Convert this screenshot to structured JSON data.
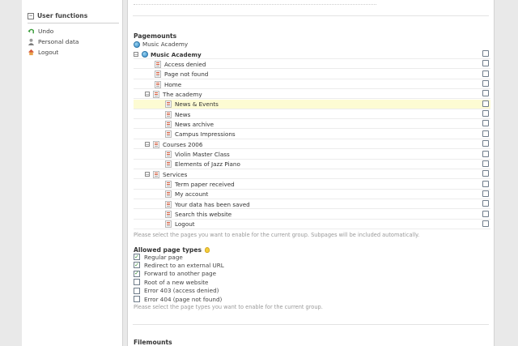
{
  "sidebar": {
    "header": "User functions",
    "items": [
      {
        "label": "Undo",
        "icon": "undo-icon",
        "color": "#3a9d3a"
      },
      {
        "label": "Personal data",
        "icon": "user-icon",
        "color": "#7a7a7a"
      },
      {
        "label": "Logout",
        "icon": "home-icon",
        "color": "#d4563a"
      }
    ]
  },
  "pagemounts": {
    "title": "Pagemounts",
    "root_label": "Music Academy",
    "tree": [
      {
        "label": "Music Academy",
        "bold": true,
        "level": 0,
        "expander": "−",
        "icon": "globe-icon"
      },
      {
        "label": "Access denied",
        "level": 1,
        "icon": "page-icon"
      },
      {
        "label": "Page not found",
        "level": 1,
        "icon": "page-icon"
      },
      {
        "label": "Home",
        "level": 1,
        "icon": "page-icon"
      },
      {
        "label": "The academy",
        "level": 1,
        "expander": "−",
        "icon": "page-icon"
      },
      {
        "label": "News & Events",
        "level": 2,
        "icon": "page-icon",
        "highlight": true
      },
      {
        "label": "News",
        "level": 2,
        "icon": "page-icon"
      },
      {
        "label": "News archive",
        "level": 2,
        "icon": "page-icon"
      },
      {
        "label": "Campus Impressions",
        "level": 2,
        "icon": "page-icon"
      },
      {
        "label": "Courses 2006",
        "level": 1,
        "expander": "−",
        "icon": "page-icon"
      },
      {
        "label": "Violin Master Class",
        "level": 2,
        "icon": "page-icon"
      },
      {
        "label": "Elements of Jazz Piano",
        "level": 2,
        "icon": "page-icon"
      },
      {
        "label": "Services",
        "level": 1,
        "expander": "−",
        "icon": "page-icon"
      },
      {
        "label": "Term paper received",
        "level": 2,
        "icon": "page-icon"
      },
      {
        "label": "My account",
        "level": 2,
        "icon": "page-icon"
      },
      {
        "label": "Your data has been saved",
        "level": 2,
        "icon": "page-icon"
      },
      {
        "label": "Search this website",
        "level": 2,
        "icon": "page-icon"
      },
      {
        "label": "Logout",
        "level": 2,
        "icon": "page-icon"
      }
    ],
    "note": "Please select the pages you want to enable for the current group. Subpages will be included automatically."
  },
  "page_types": {
    "title": "Allowed page types",
    "items": [
      {
        "label": "Regular page",
        "checked": true
      },
      {
        "label": "Redirect to an external URL",
        "checked": true
      },
      {
        "label": "Forward to another page",
        "checked": true
      },
      {
        "label": "Root of a new website",
        "checked": false
      },
      {
        "label": "Error 403 (access denied)",
        "checked": false
      },
      {
        "label": "Error 404 (page not found)",
        "checked": false
      }
    ],
    "note": "Please select the page types you want to enable for the current group."
  },
  "filemounts": {
    "title": "Filemounts"
  },
  "colors": {
    "highlight_row": "#fdfbd3",
    "check": "#2f8a2f"
  }
}
